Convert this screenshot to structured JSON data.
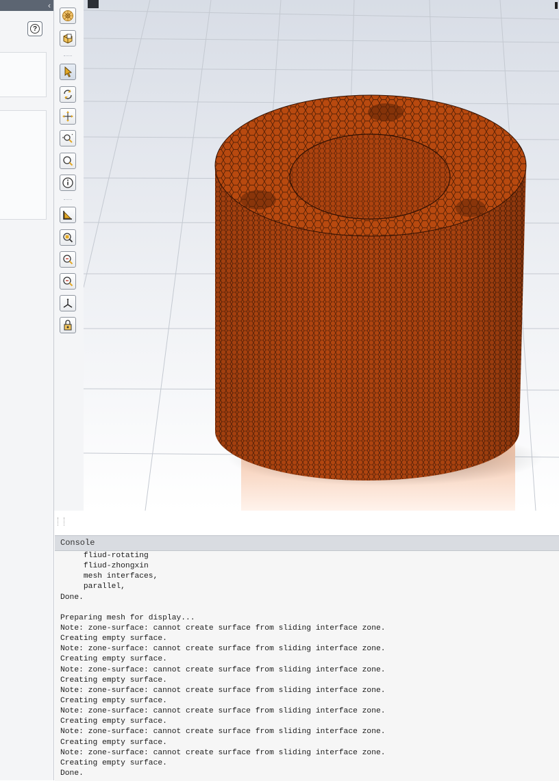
{
  "left_panel": {
    "collapse_glyph": "‹",
    "help_glyph": "?"
  },
  "toolbar": {
    "buttons": [
      {
        "id": "mesh-display",
        "icon": "mesh-sphere-icon"
      },
      {
        "id": "view-box",
        "icon": "view-cube-icon"
      },
      {
        "id": "select",
        "icon": "pointer-arrow-icon"
      },
      {
        "id": "rotate",
        "icon": "rotate-icon"
      },
      {
        "id": "pan",
        "icon": "pan-arrows-icon"
      },
      {
        "id": "zoom-in-out",
        "icon": "zoom-in-out-icon"
      },
      {
        "id": "zoom-to-area",
        "icon": "zoom-box-icon"
      },
      {
        "id": "probe",
        "icon": "info-icon"
      },
      {
        "id": "projection",
        "icon": "projection-icon"
      },
      {
        "id": "fit-to-window",
        "icon": "zoom-fit-icon"
      },
      {
        "id": "zoom-in",
        "icon": "zoom-in-icon"
      },
      {
        "id": "zoom-out",
        "icon": "zoom-out-icon"
      },
      {
        "id": "axes",
        "icon": "axes-icon"
      },
      {
        "id": "lock-view",
        "icon": "lock-view-icon"
      }
    ]
  },
  "graphics": {
    "mesh_color": "#b8490f",
    "background_top": "#d8dde6",
    "background_bottom": "#ffffff"
  },
  "console": {
    "title": "Console",
    "lines": [
      "     fliud-rotating",
      "     fliud-zhongxin",
      "     mesh interfaces,",
      "     parallel,",
      "Done.",
      "",
      "Preparing mesh for display...",
      "Note: zone-surface: cannot create surface from sliding interface zone.",
      "Creating empty surface.",
      "Note: zone-surface: cannot create surface from sliding interface zone.",
      "Creating empty surface.",
      "Note: zone-surface: cannot create surface from sliding interface zone.",
      "Creating empty surface.",
      "Note: zone-surface: cannot create surface from sliding interface zone.",
      "Creating empty surface.",
      "Note: zone-surface: cannot create surface from sliding interface zone.",
      "Creating empty surface.",
      "Note: zone-surface: cannot create surface from sliding interface zone.",
      "Creating empty surface.",
      "Note: zone-surface: cannot create surface from sliding interface zone.",
      "Creating empty surface.",
      "Done."
    ]
  }
}
